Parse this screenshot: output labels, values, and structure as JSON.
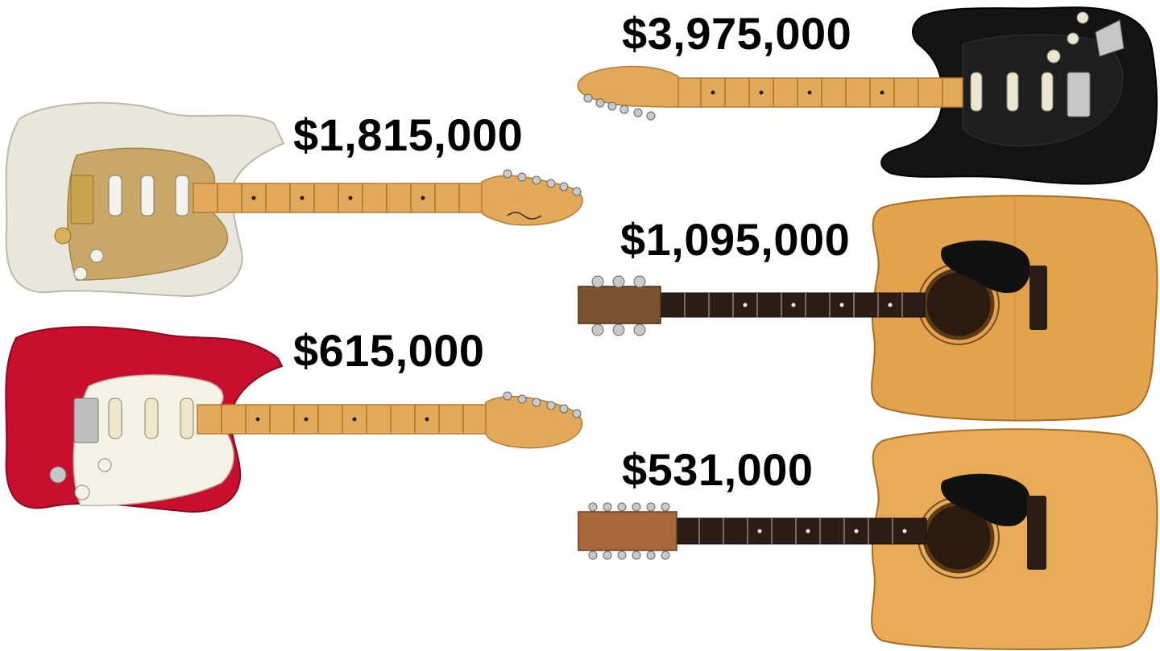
{
  "prices": {
    "white_strat": "$1,815,000",
    "red_strat": "$615,000",
    "black_strat": "$3,975,000",
    "acoustic_6": "$1,095,000",
    "acoustic_12": "$531,000"
  },
  "colors": {
    "background": "#ffffff",
    "price_text": "#000000",
    "white_body": "#e9e7dc",
    "red_body": "#c8102e",
    "black_body": "#141414",
    "gold_pickguard": "#c9a766",
    "maple_neck": "#e2a95a",
    "acoustic_top": "#e3a24c",
    "acoustic_pickguard": "#111111",
    "rosewood_fretboard": "#2a1d16"
  }
}
